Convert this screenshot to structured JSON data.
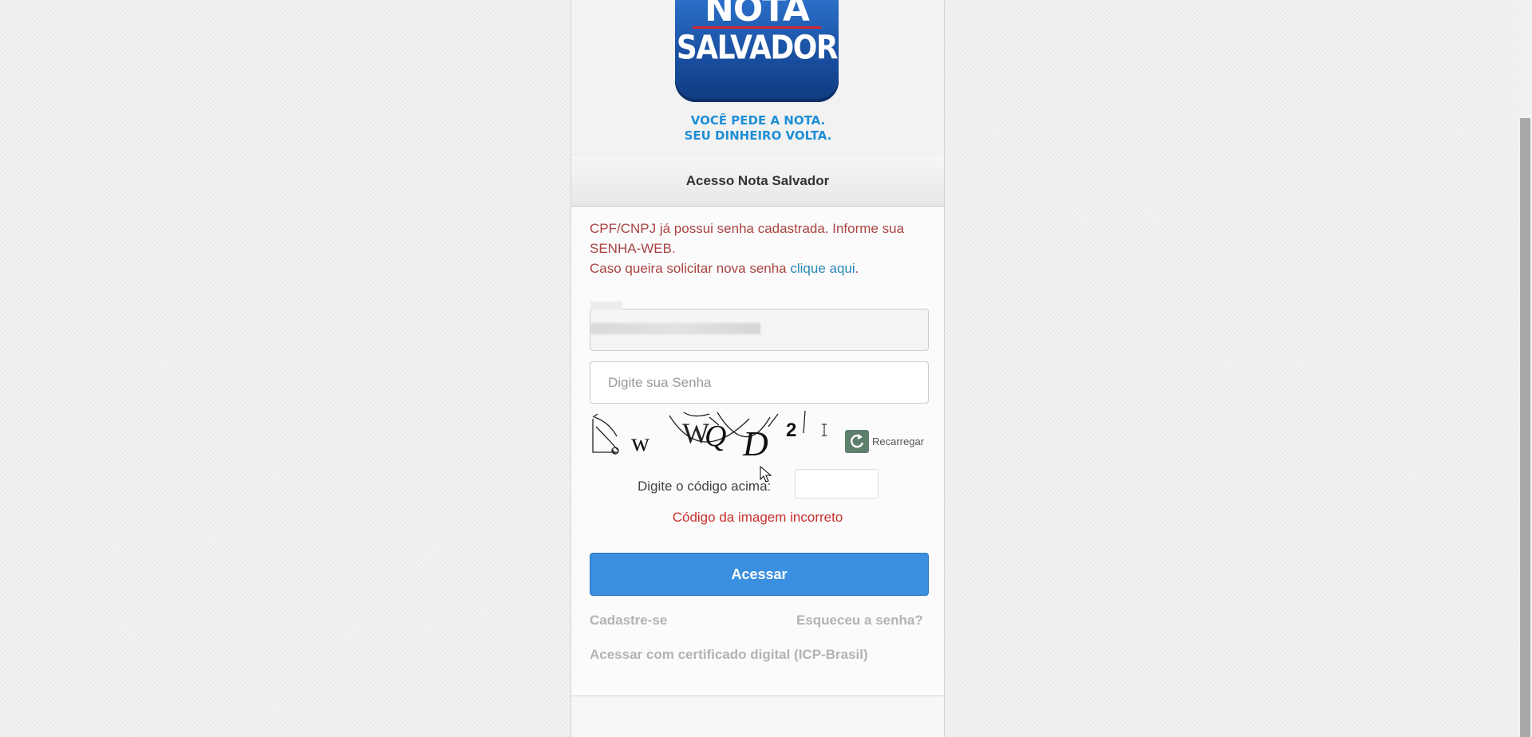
{
  "logo": {
    "line1": "NOTA",
    "line2": "SALVADOR",
    "tagline1": "VOCÊ PEDE A NOTA.",
    "tagline2": "SEU DINHEIRO VOLTA."
  },
  "header": {
    "title": "Acesso Nota Salvador"
  },
  "alert": {
    "line1": "CPF/CNPJ já possui senha cadastrada. Informe sua SENHA-WEB.",
    "line2_prefix": "Caso queira solicitar nova senha ",
    "link": "clique aqui",
    "line2_suffix": "."
  },
  "form": {
    "password_placeholder": "Digite sua Senha",
    "captcha_text": "WWQD2",
    "reload_label": "Recarregar",
    "code_label": "Digite o código acima:",
    "code_value": "",
    "error": "Código da imagem incorreto",
    "submit": "Acessar"
  },
  "links": {
    "register": "Cadastre-se",
    "forgot": "Esqueceu a senha?",
    "certificate": "Acessar com certificado digital (ICP-Brasil)"
  },
  "colors": {
    "primary_button": "#3a8fdf",
    "error_text": "#c9302c",
    "alert_text": "#a94442",
    "link": "#2a86b8",
    "logo_blue": "#1a4fa0"
  }
}
